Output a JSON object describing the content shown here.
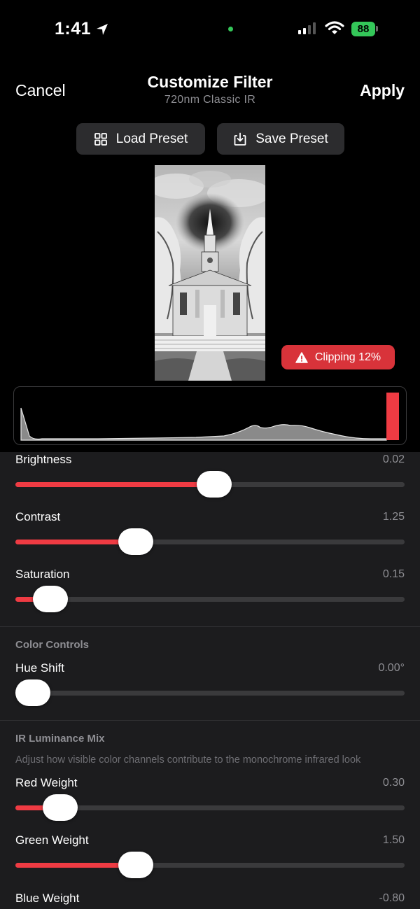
{
  "status_bar": {
    "time": "1:41",
    "battery": "88"
  },
  "nav": {
    "cancel": "Cancel",
    "title": "Customize Filter",
    "subtitle": "720nm Classic IR",
    "apply": "Apply"
  },
  "presets": {
    "load": "Load Preset",
    "save": "Save Preset"
  },
  "preview": {
    "clipping_badge": "Clipping 12%"
  },
  "adjustments": {
    "brightness": {
      "label": "Brightness",
      "value": "0.02",
      "fraction": 0.51
    },
    "contrast": {
      "label": "Contrast",
      "value": "1.25",
      "fraction": 0.31
    },
    "saturation": {
      "label": "Saturation",
      "value": "0.15",
      "fraction": 0.09
    }
  },
  "color_controls": {
    "header": "Color Controls",
    "hue_shift": {
      "label": "Hue Shift",
      "value": "0.00°",
      "fraction": 0.045
    }
  },
  "ir_mix": {
    "header": "IR Luminance Mix",
    "description": "Adjust how visible color channels contribute to the monochrome infrared look",
    "red": {
      "label": "Red Weight",
      "value": "0.30",
      "fraction": 0.115
    },
    "green": {
      "label": "Green Weight",
      "value": "1.50",
      "fraction": 0.31
    },
    "blue": {
      "label": "Blue Weight",
      "value": "-0.80"
    }
  },
  "colors": {
    "accent": "#ef3b43",
    "badge": "#d8333a",
    "battery": "#34c759",
    "panel": "#1c1c1e"
  },
  "icons": {
    "location": "location-arrow-icon",
    "load": "grid-icon",
    "save": "download-tray-icon",
    "warning": "warning-triangle-icon"
  }
}
